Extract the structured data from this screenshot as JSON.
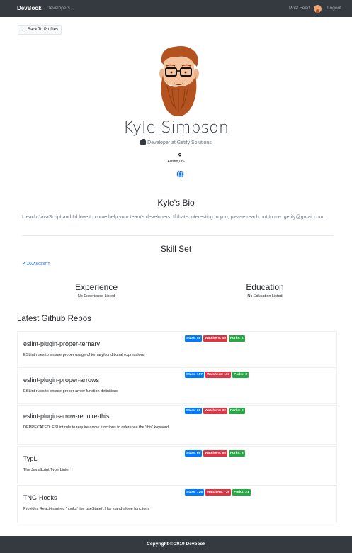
{
  "navbar": {
    "brand": "DevBook",
    "developers": "Developers",
    "post_feed": "Post Feed",
    "logout": "Logout"
  },
  "back_button": {
    "label": "Back To Profiles",
    "icon": "arrow-left-icon"
  },
  "profile": {
    "name": "Kyle Simpson",
    "status": "Developer at Getify Solutions",
    "location": "Austin,US",
    "website_icon": "globe-icon"
  },
  "bio": {
    "title": "Kyle's Bio",
    "text": "I teach JavaScript and I'd love to come help your team's developers. If that's interesting to you, please reach out to me: getify@gmail.com."
  },
  "skills": {
    "title": "Skill Set",
    "items": [
      "JAVASCRIPT"
    ]
  },
  "experience": {
    "title": "Experience",
    "empty_text": "No Experience Listed"
  },
  "education": {
    "title": "Education",
    "empty_text": "No Education Listed"
  },
  "repos": {
    "title": "Latest Github Repos",
    "items": [
      {
        "name": "eslint-plugin-proper-ternary",
        "description": "ESLint rules to ensure proper usage of ternary/conditional expressions",
        "stars": "Stars: 49",
        "watchers": "Watchers: 49",
        "forks": "Forks: 2"
      },
      {
        "name": "eslint-plugin-proper-arrows",
        "description": "ESLint rules to ensure proper arrow function definitions",
        "stars": "Stars: 167",
        "watchers": "Watchers: 167",
        "forks": "Forks: 3"
      },
      {
        "name": "eslint-plugin-arrow-require-this",
        "description": "DEPRECATED: ESLint rule to require arrow functions to reference the 'this' keyword",
        "stars": "Stars: 30",
        "watchers": "Watchers: 30",
        "forks": "Forks: 2"
      },
      {
        "name": "TypL",
        "description": "The JavaScript Type Linter",
        "stars": "Stars: 65",
        "watchers": "Watchers: 65",
        "forks": "Forks: 6"
      },
      {
        "name": "TNG-Hooks",
        "description": "Provides React-inspired 'hooks' like useState(..) for stand-alone functions",
        "stars": "Stars: 726",
        "watchers": "Watchers: 726",
        "forks": "Forks: 21"
      }
    ]
  },
  "footer": {
    "text": "Copyright © 2019 Devbook"
  },
  "colors": {
    "navbar": "#343a40",
    "stars_badge": "#007bff",
    "watchers_badge": "#dc3545",
    "forks_badge": "#28a745",
    "skill_link": "#1a73e8"
  }
}
